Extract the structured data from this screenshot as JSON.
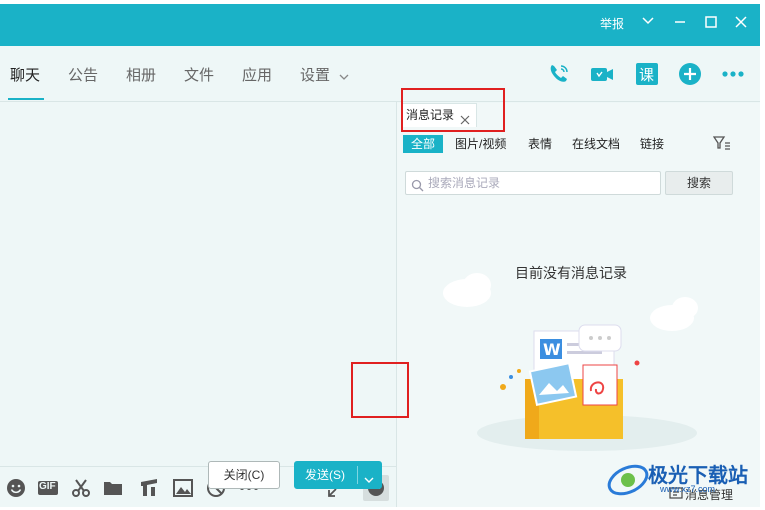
{
  "titlebar": {
    "report_label": "举报",
    "min_icon": "minimize-icon",
    "max_icon": "maximize-icon",
    "close_icon": "close-icon",
    "color": "#1ab2c7"
  },
  "nav": {
    "tabs": [
      {
        "label": "聊天",
        "active": true
      },
      {
        "label": "公告"
      },
      {
        "label": "相册"
      },
      {
        "label": "文件"
      },
      {
        "label": "应用"
      },
      {
        "label": "设置"
      }
    ],
    "icons": [
      "phone-icon",
      "video-icon",
      "course-icon",
      "add-icon",
      "more-icon"
    ],
    "course_label": "课"
  },
  "toolbar": {
    "icons": [
      "emoji-icon",
      "gif-icon",
      "scissors-icon",
      "folder-icon",
      "music-icon",
      "image-icon",
      "block-icon",
      "more-icon",
      "expand-icon",
      "history-icon"
    ],
    "gif_label": "GIF"
  },
  "actions": {
    "close_label": "关闭(C)",
    "send_label": "发送(S)"
  },
  "history": {
    "tab_label": "消息记录",
    "filters": [
      "全部",
      "图片/视频",
      "表情",
      "在线文档",
      "链接"
    ],
    "search_placeholder": "搜索消息记录",
    "search_button": "搜索",
    "empty_text": "目前没有消息记录",
    "manage_label": "消息管理"
  },
  "watermark": {
    "text": "极光下载站",
    "url": "www.xz7.com"
  }
}
